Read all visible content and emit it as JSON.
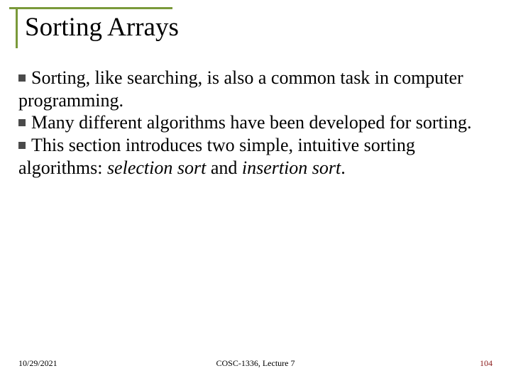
{
  "slide": {
    "title": "Sorting Arrays",
    "bullets": {
      "b1": "Sorting, like searching, is also a common task in computer programming.",
      "b2": "Many different algorithms have been developed for sorting.",
      "b3_pre": "This section introduces two simple, intuitive sorting algorithms: ",
      "b3_em1": "selection sort",
      "b3_mid": " and ",
      "b3_em2": "insertion sort",
      "b3_post": "."
    }
  },
  "footer": {
    "date": "10/29/2021",
    "course": "COSC-1336, Lecture 7",
    "page": "104"
  }
}
